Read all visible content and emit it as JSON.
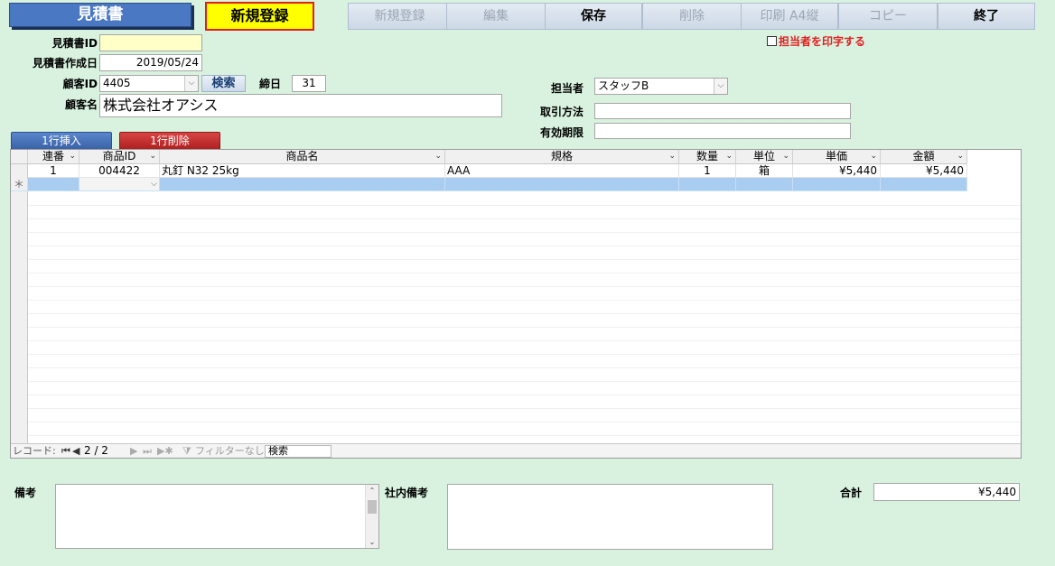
{
  "header": {
    "title": "見積書",
    "mode": "新規登録"
  },
  "toolbar": {
    "new": "新規登録",
    "edit": "編集",
    "save": "保存",
    "delete": "削除",
    "print": "印刷 A4縦",
    "copy": "コピー",
    "exit": "終了"
  },
  "print_staff_label": "担当者を印字する",
  "form": {
    "estimate_id_label": "見積書ID",
    "estimate_id_value": "",
    "created_date_label": "見積書作成日",
    "created_date_value": "2019/05/24",
    "customer_id_label": "顧客ID",
    "customer_id_value": "4405",
    "search_label": "検索",
    "closing_day_label": "締日",
    "closing_day_value": "31",
    "customer_name_label": "顧客名",
    "customer_name_value": "株式会社オアシス",
    "staff_label": "担当者",
    "staff_value": "スタッフB",
    "payment_method_label": "取引方法",
    "payment_method_value": "",
    "validity_label": "有効期限",
    "validity_value": ""
  },
  "row_buttons": {
    "insert": "1行挿入",
    "delete": "1行削除"
  },
  "grid": {
    "columns": [
      "連番",
      "商品ID",
      "商品名",
      "規格",
      "数量",
      "単位",
      "単価",
      "金額"
    ],
    "rows": [
      {
        "seq": "1",
        "product_id": "004422",
        "product_name": "丸釘 N32 25kg",
        "spec": "AAA",
        "qty": "1",
        "unit": "箱",
        "price": "¥5,440",
        "amount": "¥5,440"
      }
    ],
    "new_row_marker": "＊"
  },
  "navbar": {
    "record_label": "レコード:",
    "record_position": "2 / 2",
    "filter_label": "フィルターなし",
    "search_label": "検索"
  },
  "footer": {
    "remarks_label": "備考",
    "remarks_value": "",
    "internal_remarks_label": "社内備考",
    "internal_remarks_value": "",
    "total_label": "合計",
    "total_value": "¥5,440"
  }
}
